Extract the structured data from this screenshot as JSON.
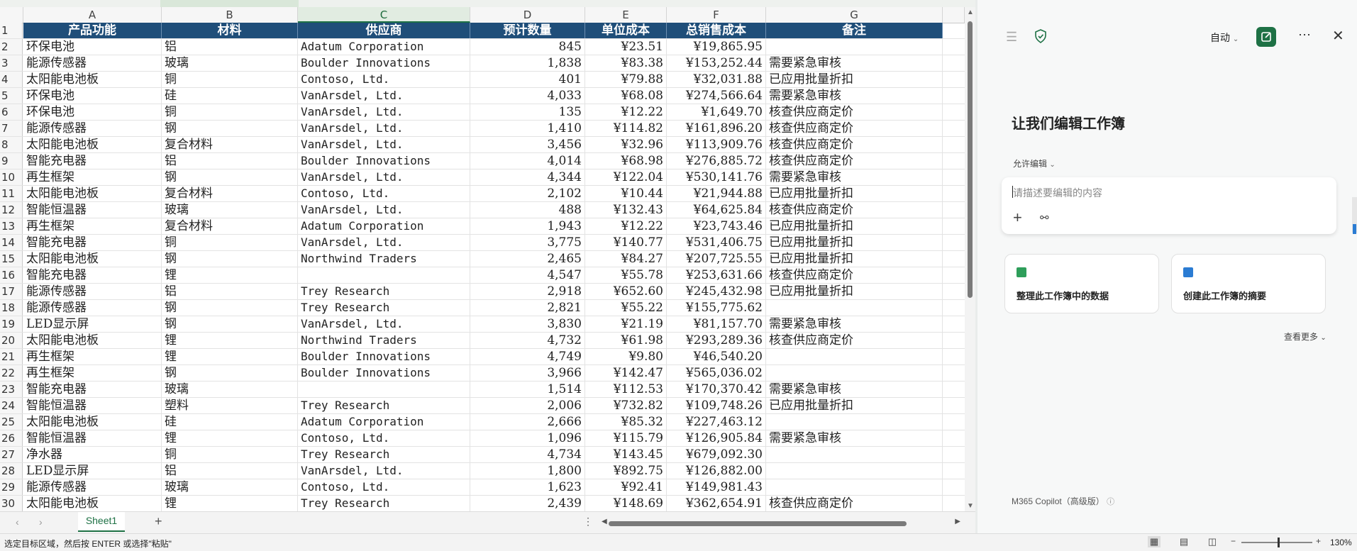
{
  "sheet": {
    "columns": [
      "A",
      "B",
      "C",
      "D",
      "E",
      "F",
      "G"
    ],
    "header": [
      "产品功能",
      "材料",
      "供应商",
      "预计数量",
      "单位成本",
      "总销售成本",
      "备注"
    ],
    "rows": [
      [
        "2",
        "环保电池",
        "铝",
        "Adatum Corporation",
        "845",
        "¥23.51",
        "¥19,865.95",
        ""
      ],
      [
        "3",
        "能源传感器",
        "玻璃",
        "Boulder Innovations",
        "1,838",
        "¥83.38",
        "¥153,252.44",
        "需要紧急审核"
      ],
      [
        "4",
        "太阳能电池板",
        "铜",
        "Contoso, Ltd.",
        "401",
        "¥79.88",
        "¥32,031.88",
        "已应用批量折扣"
      ],
      [
        "5",
        "环保电池",
        "硅",
        "VanArsdel, Ltd.",
        "4,033",
        "¥68.08",
        "¥274,566.64",
        "需要紧急审核"
      ],
      [
        "6",
        "环保电池",
        "铜",
        "VanArsdel, Ltd.",
        "135",
        "¥12.22",
        "¥1,649.70",
        "核查供应商定价"
      ],
      [
        "7",
        "能源传感器",
        "钢",
        "VanArsdel, Ltd.",
        "1,410",
        "¥114.82",
        "¥161,896.20",
        "核查供应商定价"
      ],
      [
        "8",
        "太阳能电池板",
        "复合材料",
        "VanArsdel, Ltd.",
        "3,456",
        "¥32.96",
        "¥113,909.76",
        "核查供应商定价"
      ],
      [
        "9",
        "智能充电器",
        "铝",
        "Boulder Innovations",
        "4,014",
        "¥68.98",
        "¥276,885.72",
        "核查供应商定价"
      ],
      [
        "10",
        "再生框架",
        "钢",
        "VanArsdel, Ltd.",
        "4,344",
        "¥122.04",
        "¥530,141.76",
        "需要紧急审核"
      ],
      [
        "11",
        "太阳能电池板",
        "复合材料",
        "Contoso, Ltd.",
        "2,102",
        "¥10.44",
        "¥21,944.88",
        "已应用批量折扣"
      ],
      [
        "12",
        "智能恒温器",
        "玻璃",
        "VanArsdel, Ltd.",
        "488",
        "¥132.43",
        "¥64,625.84",
        "核查供应商定价"
      ],
      [
        "13",
        "再生框架",
        "复合材料",
        "Adatum Corporation",
        "1,943",
        "¥12.22",
        "¥23,743.46",
        "已应用批量折扣"
      ],
      [
        "14",
        "智能充电器",
        "铜",
        "VanArsdel, Ltd.",
        "3,775",
        "¥140.77",
        "¥531,406.75",
        "已应用批量折扣"
      ],
      [
        "15",
        "太阳能电池板",
        "钢",
        "Northwind Traders",
        "2,465",
        "¥84.27",
        "¥207,725.55",
        "已应用批量折扣"
      ],
      [
        "16",
        "智能充电器",
        "锂",
        "",
        "4,547",
        "¥55.78",
        "¥253,631.66",
        "核查供应商定价"
      ],
      [
        "17",
        "能源传感器",
        "铝",
        "Trey Research",
        "2,918",
        "¥652.60",
        "¥245,432.98",
        "已应用批量折扣"
      ],
      [
        "18",
        "能源传感器",
        "钢",
        "Trey Research",
        "2,821",
        "¥55.22",
        "¥155,775.62",
        ""
      ],
      [
        "19",
        "LED显示屏",
        "钢",
        "VanArsdel, Ltd.",
        "3,830",
        "¥21.19",
        "¥81,157.70",
        "需要紧急审核"
      ],
      [
        "20",
        "太阳能电池板",
        "锂",
        "Northwind Traders",
        "4,732",
        "¥61.98",
        "¥293,289.36",
        "核查供应商定价"
      ],
      [
        "21",
        "再生框架",
        "锂",
        "Boulder Innovations",
        "4,749",
        "¥9.80",
        "¥46,540.20",
        ""
      ],
      [
        "22",
        "再生框架",
        "钢",
        "Boulder Innovations",
        "3,966",
        "¥142.47",
        "¥565,036.02",
        ""
      ],
      [
        "23",
        "智能充电器",
        "玻璃",
        "",
        "1,514",
        "¥112.53",
        "¥170,370.42",
        "需要紧急审核"
      ],
      [
        "24",
        "智能恒温器",
        "塑料",
        "Trey Research",
        "2,006",
        "¥732.82",
        "¥109,748.26",
        "已应用批量折扣"
      ],
      [
        "25",
        "太阳能电池板",
        "硅",
        "Adatum Corporation",
        "2,666",
        "¥85.32",
        "¥227,463.12",
        ""
      ],
      [
        "26",
        "智能恒温器",
        "锂",
        "Contoso, Ltd.",
        "1,096",
        "¥115.79",
        "¥126,905.84",
        "需要紧急审核"
      ],
      [
        "27",
        "净水器",
        "铜",
        "Trey Research",
        "4,734",
        "¥143.45",
        "¥679,092.30",
        ""
      ],
      [
        "28",
        "LED显示屏",
        "铝",
        "VanArsdel, Ltd.",
        "1,800",
        "¥892.75",
        "¥126,882.00",
        ""
      ],
      [
        "29",
        "能源传感器",
        "玻璃",
        "Contoso, Ltd.",
        "1,623",
        "¥92.41",
        "¥149,981.43",
        ""
      ],
      [
        "30",
        "太阳能电池板",
        "锂",
        "Trey Research",
        "2,439",
        "¥148.69",
        "¥362,654.91",
        "核查供应商定价"
      ]
    ],
    "header_row_num": "1",
    "tab_name": "Sheet1",
    "add_sheet": "+"
  },
  "panel": {
    "auto_label": "自动",
    "title": "让我们编辑工作簿",
    "edit_permission": "允许编辑",
    "input_placeholder": "请描述要编辑的内容",
    "suggestions": [
      {
        "label": "整理此工作簿中的数据",
        "icon": "grid-icon",
        "color": "#2e9e5a"
      },
      {
        "label": "创建此工作簿的摘要",
        "icon": "list-icon",
        "color": "#2b7cd3"
      }
    ],
    "see_more": "查看更多",
    "footer": "M365 Copilot（高级版）",
    "accent": "#1e7145"
  },
  "status": {
    "text": "选定目标区域，然后按 ENTER 或选择\"粘贴\"",
    "zoom": "130%",
    "zoom_minus": "−",
    "zoom_plus": "+"
  },
  "colors": {
    "header_bg": "#1f4e79",
    "header_fg": "#ffffff",
    "excel_green": "#1e7145"
  }
}
